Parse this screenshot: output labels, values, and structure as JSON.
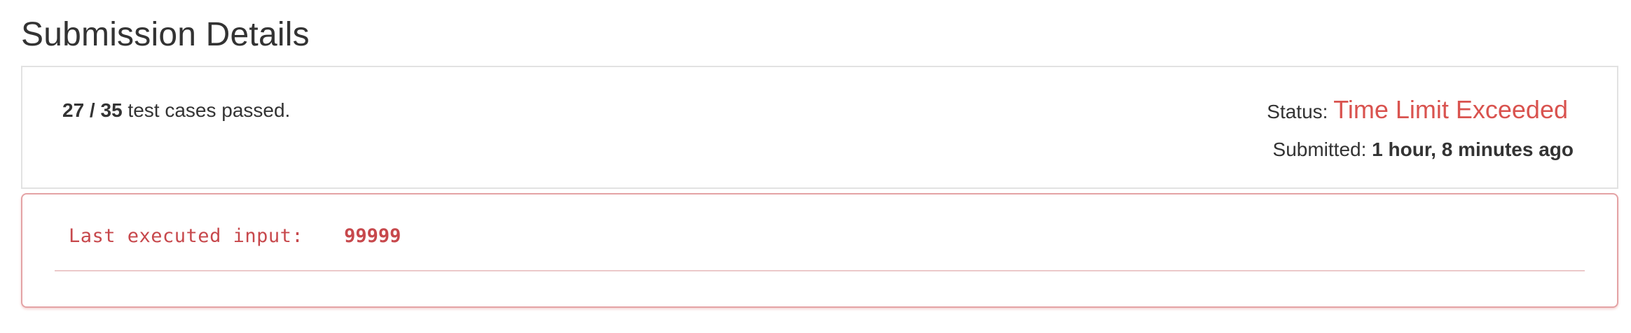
{
  "page_title": "Submission Details",
  "summary": {
    "passed": "27",
    "separator": " / ",
    "total": "35",
    "passed_suffix": " test cases passed.",
    "status_label": "Status: ",
    "status_value": "Time Limit Exceeded",
    "submitted_label": "Submitted: ",
    "submitted_value": "1 hour, 8 minutes ago"
  },
  "error": {
    "last_input_label": "Last executed input:",
    "last_input_value": "99999"
  },
  "colors": {
    "error_red": "#d9534f",
    "text": "#333333",
    "panel_border": "#e2e2e2"
  }
}
